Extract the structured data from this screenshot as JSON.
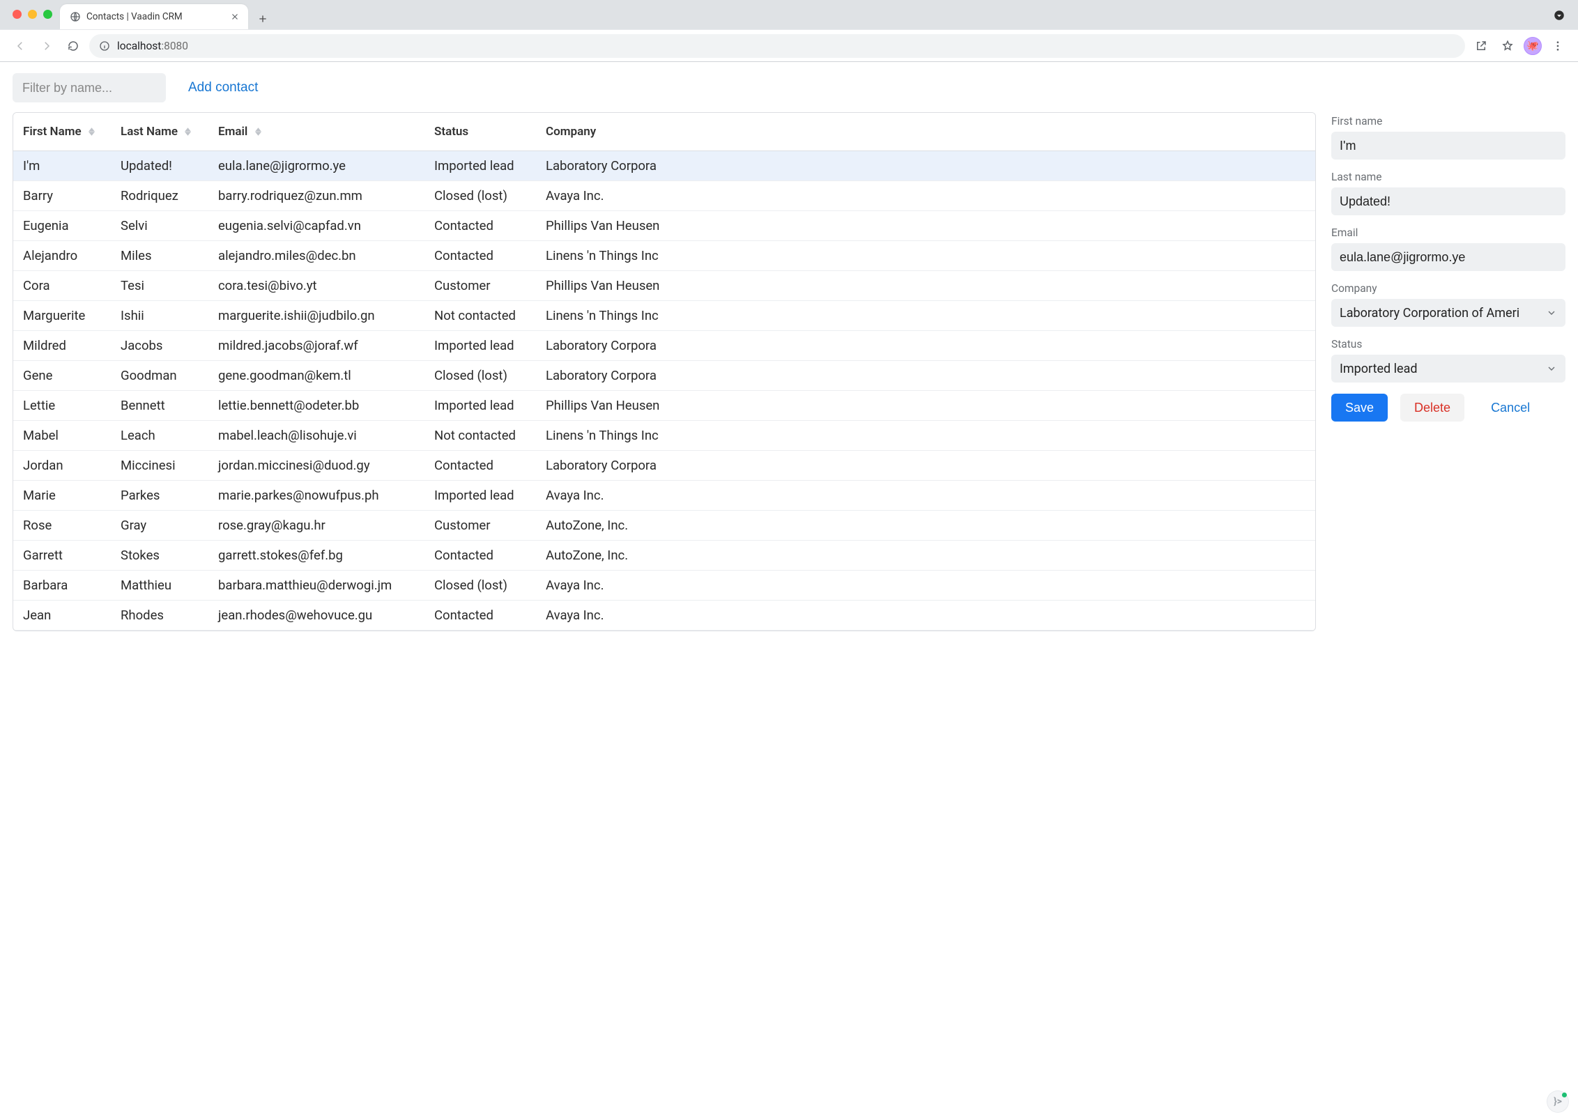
{
  "browser": {
    "tab_title": "Contacts | Vaadin CRM",
    "url_host": "localhost",
    "url_port": ":8080"
  },
  "toolbar": {
    "filter_placeholder": "Filter by name...",
    "add_contact_label": "Add contact"
  },
  "grid": {
    "headers": {
      "first_name": "First Name",
      "last_name": "Last Name",
      "email": "Email",
      "status": "Status",
      "company": "Company"
    },
    "rows": [
      {
        "first": "I'm",
        "last": "Updated!",
        "email": "eula.lane@jigrormo.ye",
        "status": "Imported lead",
        "company": "Laboratory Corpora",
        "selected": true
      },
      {
        "first": "Barry",
        "last": "Rodriquez",
        "email": "barry.rodriquez@zun.mm",
        "status": "Closed (lost)",
        "company": "Avaya Inc."
      },
      {
        "first": "Eugenia",
        "last": "Selvi",
        "email": "eugenia.selvi@capfad.vn",
        "status": "Contacted",
        "company": "Phillips Van Heusen"
      },
      {
        "first": "Alejandro",
        "last": "Miles",
        "email": "alejandro.miles@dec.bn",
        "status": "Contacted",
        "company": "Linens 'n Things Inc"
      },
      {
        "first": "Cora",
        "last": "Tesi",
        "email": "cora.tesi@bivo.yt",
        "status": "Customer",
        "company": "Phillips Van Heusen"
      },
      {
        "first": "Marguerite",
        "last": "Ishii",
        "email": "marguerite.ishii@judbilo.gn",
        "status": "Not contacted",
        "company": "Linens 'n Things Inc"
      },
      {
        "first": "Mildred",
        "last": "Jacobs",
        "email": "mildred.jacobs@joraf.wf",
        "status": "Imported lead",
        "company": "Laboratory Corpora"
      },
      {
        "first": "Gene",
        "last": "Goodman",
        "email": "gene.goodman@kem.tl",
        "status": "Closed (lost)",
        "company": "Laboratory Corpora"
      },
      {
        "first": "Lettie",
        "last": "Bennett",
        "email": "lettie.bennett@odeter.bb",
        "status": "Imported lead",
        "company": "Phillips Van Heusen"
      },
      {
        "first": "Mabel",
        "last": "Leach",
        "email": "mabel.leach@lisohuje.vi",
        "status": "Not contacted",
        "company": "Linens 'n Things Inc"
      },
      {
        "first": "Jordan",
        "last": "Miccinesi",
        "email": "jordan.miccinesi@duod.gy",
        "status": "Contacted",
        "company": "Laboratory Corpora"
      },
      {
        "first": "Marie",
        "last": "Parkes",
        "email": "marie.parkes@nowufpus.ph",
        "status": "Imported lead",
        "company": "Avaya Inc."
      },
      {
        "first": "Rose",
        "last": "Gray",
        "email": "rose.gray@kagu.hr",
        "status": "Customer",
        "company": "AutoZone, Inc."
      },
      {
        "first": "Garrett",
        "last": "Stokes",
        "email": "garrett.stokes@fef.bg",
        "status": "Contacted",
        "company": "AutoZone, Inc."
      },
      {
        "first": "Barbara",
        "last": "Matthieu",
        "email": "barbara.matthieu@derwogi.jm",
        "status": "Closed (lost)",
        "company": "Avaya Inc."
      },
      {
        "first": "Jean",
        "last": "Rhodes",
        "email": "jean.rhodes@wehovuce.gu",
        "status": "Contacted",
        "company": "Avaya Inc."
      }
    ]
  },
  "form": {
    "labels": {
      "first_name": "First name",
      "last_name": "Last name",
      "email": "Email",
      "company": "Company",
      "status": "Status"
    },
    "values": {
      "first_name": "I'm",
      "last_name": "Updated!",
      "email": "eula.lane@jigrormo.ye",
      "company": "Laboratory Corporation of Ameri",
      "status": "Imported lead"
    },
    "buttons": {
      "save": "Save",
      "delete": "Delete",
      "cancel": "Cancel"
    }
  }
}
